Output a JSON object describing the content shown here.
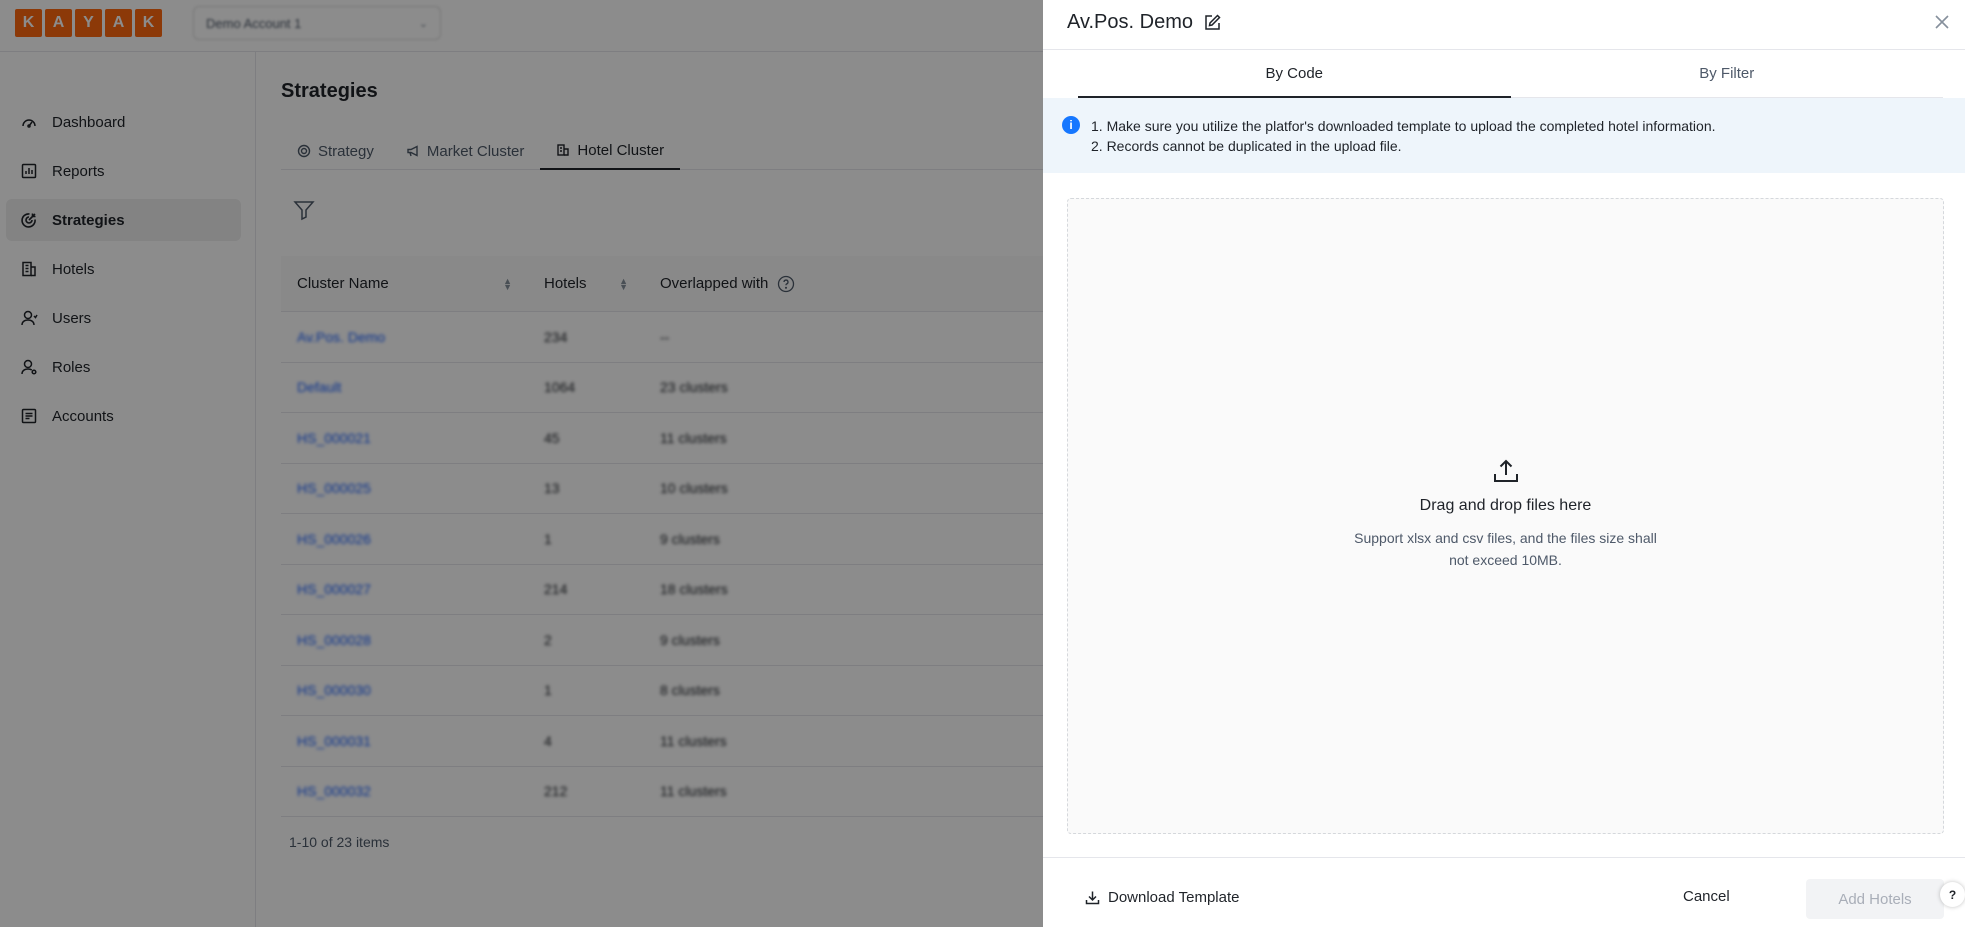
{
  "app": {
    "logo_letters": [
      "K",
      "A",
      "Y",
      "A",
      "K"
    ],
    "account": "Demo Account 1"
  },
  "sidebar": {
    "items": [
      {
        "label": "Dashboard",
        "icon": "dashboard-icon"
      },
      {
        "label": "Reports",
        "icon": "reports-icon"
      },
      {
        "label": "Strategies",
        "icon": "strategies-icon",
        "active": true
      },
      {
        "label": "Hotels",
        "icon": "hotels-icon"
      },
      {
        "label": "Users",
        "icon": "users-icon"
      },
      {
        "label": "Roles",
        "icon": "roles-icon"
      },
      {
        "label": "Accounts",
        "icon": "accounts-icon"
      }
    ]
  },
  "main": {
    "title": "Strategies",
    "tabs": [
      {
        "label": "Strategy",
        "icon": "target-icon"
      },
      {
        "label": "Market Cluster",
        "icon": "megaphone-icon"
      },
      {
        "label": "Hotel Cluster",
        "icon": "building-icon",
        "active": true
      }
    ],
    "table": {
      "columns": [
        "Cluster Name",
        "Hotels",
        "Overlapped with"
      ],
      "rows": [
        [
          "Av.Pos. Demo",
          "234",
          "--"
        ],
        [
          "Default",
          "1064",
          "23 clusters"
        ],
        [
          "HS_000021",
          "45",
          "11 clusters"
        ],
        [
          "HS_000025",
          "13",
          "10 clusters"
        ],
        [
          "HS_000026",
          "1",
          "9 clusters"
        ],
        [
          "HS_000027",
          "214",
          "18 clusters"
        ],
        [
          "HS_000028",
          "2",
          "9 clusters"
        ],
        [
          "HS_000030",
          "1",
          "8 clusters"
        ],
        [
          "HS_000031",
          "4",
          "11 clusters"
        ],
        [
          "HS_000032",
          "212",
          "11 clusters"
        ]
      ]
    },
    "pagination": "1-10 of 23 items"
  },
  "drawer": {
    "title": "Av.Pos. Demo",
    "tabs": [
      "By Code",
      "By Filter"
    ],
    "active_tab": "By Code",
    "info_lines": [
      "1. Make sure you utilize the platfor's downloaded template to upload the completed hotel information.",
      "2. Records cannot be duplicated in the upload file."
    ],
    "dropzone": {
      "title": "Drag and drop files here",
      "subtitle": "Support xlsx and csv files, and the files size shall not exceed 10MB."
    },
    "footer": {
      "download_label": "Download Template",
      "cancel_label": "Cancel",
      "add_label": "Add Hotels",
      "help_glyph": "?"
    }
  },
  "colors": {
    "brand": "#ff690f",
    "link": "#165dff",
    "info_bg": "#eef5fb",
    "info_icon": "#1677ff"
  }
}
